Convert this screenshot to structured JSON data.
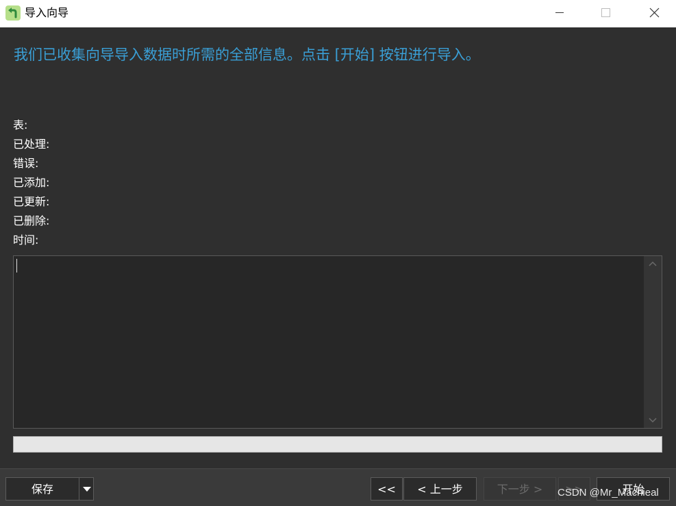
{
  "window": {
    "title": "导入向导",
    "icon": "import-wizard-icon"
  },
  "main": {
    "headline": "我们已收集向导导入数据时所需的全部信息。点击 [开始] 按钮进行导入。",
    "stats": [
      {
        "label": "表:"
      },
      {
        "label": "已处理:"
      },
      {
        "label": "错误:"
      },
      {
        "label": "已添加:"
      },
      {
        "label": "已更新:"
      },
      {
        "label": "已删除:"
      },
      {
        "label": "时间:"
      }
    ],
    "log": {
      "value": ""
    },
    "progress": {
      "percent": 0
    }
  },
  "buttons": {
    "save": "保存",
    "first": "<<",
    "prev": "< 上一步",
    "next": "下一步 >",
    "last": ">>",
    "start": "开始"
  },
  "watermark": "CSDN @Mr_Machieal",
  "colors": {
    "accent": "#3a9fd6",
    "background": "#2f2f2f",
    "bottom_bar": "#3a3a3a"
  }
}
